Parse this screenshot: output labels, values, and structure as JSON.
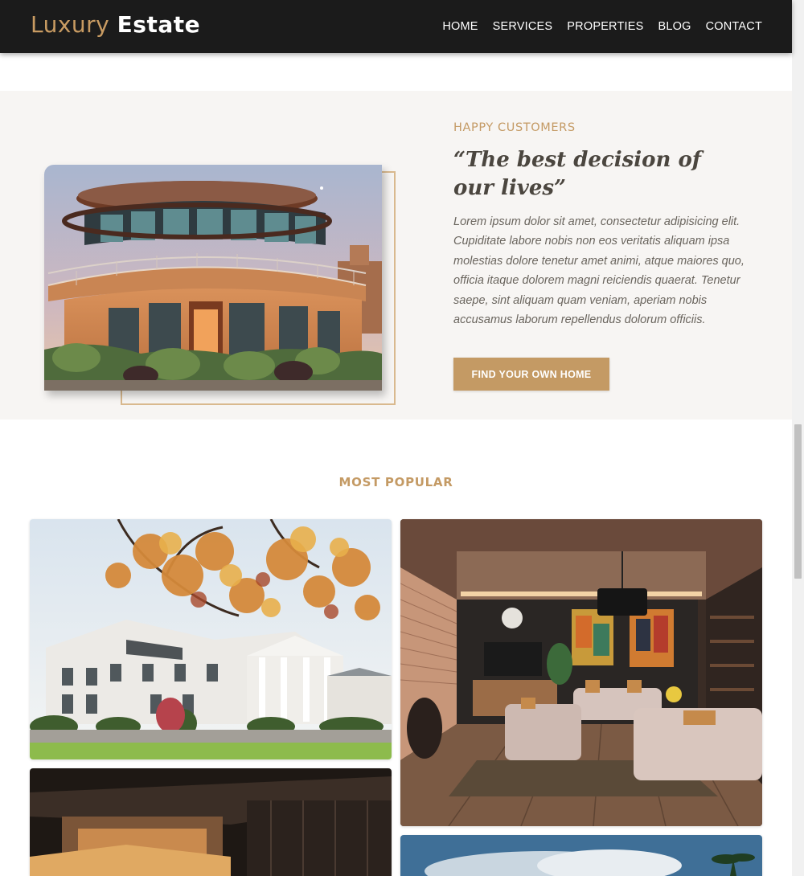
{
  "brand": {
    "part1": "Luxury",
    "part2": "Estate"
  },
  "nav": {
    "items": [
      "HOME",
      "SERVICES",
      "PROPERTIES",
      "BLOG",
      "CONTACT"
    ]
  },
  "testimonial": {
    "eyebrow": "HAPPY CUSTOMERS",
    "quote": "“The best decision of our lives”",
    "body": "Lorem ipsum dolor sit amet, consectetur adipisicing elit. Cupiditate labore nobis non eos veritatis aliquam ipsa molestias dolore tenetur amet animi, atque maiores quo, officia itaque dolorem magni reiciendis quaerat. Tenetur saepe, sint aliquam quam veniam, aperiam nobis accusamus laborum repellendus dolorum officiis.",
    "cta_label": "FIND YOUR OWN HOME"
  },
  "popular": {
    "title": "MOST POPULAR"
  },
  "colors": {
    "accent": "#c49a64",
    "nav_bg": "#1b1b1b",
    "section_bg": "#f7f5f3",
    "text_dark": "#4b463f"
  }
}
